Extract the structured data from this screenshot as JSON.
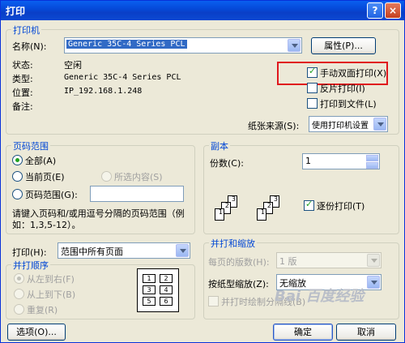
{
  "window": {
    "title": "打印",
    "btn_help": "?",
    "btn_close": "×"
  },
  "printer": {
    "group_title": "打印机",
    "name_label": "名称(N):",
    "name_value": "Generic 35C-4 Series PCL",
    "properties_btn": "属性(P)...",
    "status_label": "状态:",
    "status_value": "空闲",
    "type_label": "类型:",
    "type_value": "Generic 35C-4 Series PCL",
    "location_label": "位置:",
    "location_value": "IP_192.168.1.248",
    "comment_label": "备注:",
    "manual_duplex": "手动双面打印(X)",
    "reverse_print": "反片打印(I)",
    "print_to_file": "打印到文件(L)",
    "paper_source_label": "纸张来源(S):",
    "paper_source_value": "使用打印机设置"
  },
  "page_range": {
    "group_title": "页码范围",
    "all": "全部(A)",
    "current_page": "当前页(E)",
    "selection": "所选内容(S)",
    "pages": "页码范围(G):",
    "hint": "请键入页码和/或用逗号分隔的页码范围（例如：1,3,5-12）。"
  },
  "copies": {
    "group_title": "副本",
    "count_label": "份数(C):",
    "count_value": "1",
    "collate": "逐份打印(T)",
    "page_numbers": [
      "1",
      "2",
      "3",
      "1",
      "2",
      "3"
    ]
  },
  "print_what": {
    "label": "打印(H):",
    "value": "范围中所有页面"
  },
  "order": {
    "group_title": "并打顺序",
    "left_right": "从左到右(F)",
    "top_bottom": "从上到下(B)",
    "repeat": "重复(R)",
    "grid_numbers": [
      "1",
      "2",
      "3",
      "4",
      "5",
      "6"
    ]
  },
  "zoom": {
    "group_title": "并打和缩放",
    "pages_per_sheet_label": "每页的版数(H):",
    "pages_per_sheet_value": "1 版",
    "scale_label": "按纸型缩放(Z):",
    "scale_value": "无缩放",
    "draw_borders": "并打时绘制分隔线(B)"
  },
  "footer": {
    "options_btn": "选项(O)...",
    "ok_btn": "确定",
    "cancel_btn": "取消"
  },
  "watermark": "Bai 百度经验"
}
